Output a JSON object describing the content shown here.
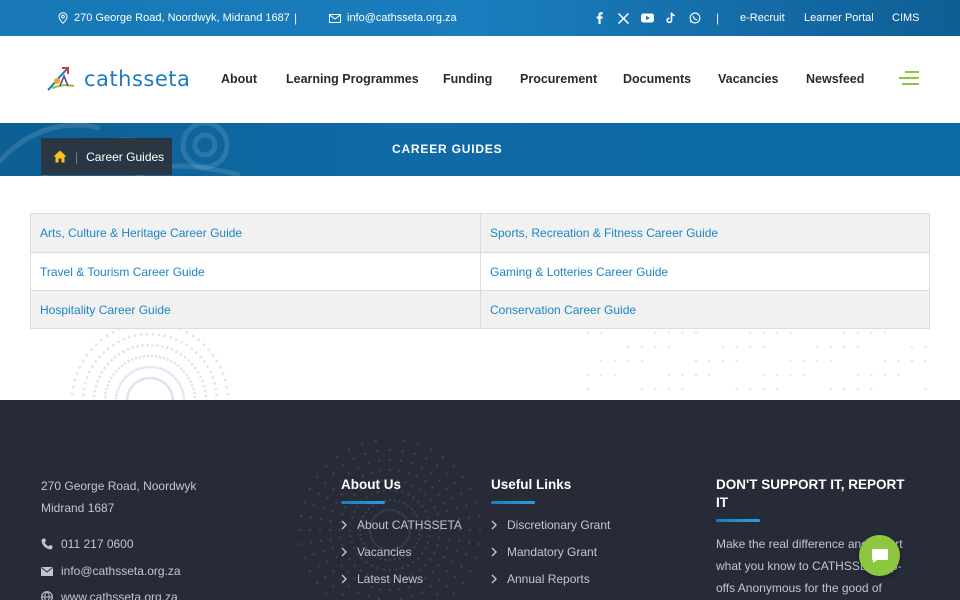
{
  "topbar": {
    "address": "270 George Road, Noordwyk, Midrand 1687",
    "email": "info@cathsseta.org.za",
    "divider": "|",
    "social": [
      "facebook-icon",
      "x-icon",
      "youtube-icon",
      "tiktok-icon",
      "whatsapp-icon"
    ],
    "links": [
      "e-Recruit",
      "Learner Portal",
      "CIMS"
    ]
  },
  "header": {
    "logo_text": "cathsseta",
    "nav": [
      "About",
      "Learning Programmes",
      "Funding",
      "Procurement",
      "Documents",
      "Vacancies",
      "Newsfeed"
    ]
  },
  "banner": {
    "title": "CAREER GUIDES",
    "breadcrumb_current": "Career Guides",
    "breadcrumb_sep": "|"
  },
  "guides": [
    [
      "Arts, Culture & Heritage Career Guide",
      "Sports, Recreation & Fitness Career Guide"
    ],
    [
      "Travel & Tourism Career Guide",
      "Gaming & Lotteries Career Guide"
    ],
    [
      "Hospitality Career Guide",
      "Conservation Career Guide"
    ]
  ],
  "footer": {
    "address_line1": "270 George Road, Noordwyk",
    "address_line2": "Midrand 1687",
    "phone": "011 217 0600",
    "email": "info@cathsseta.org.za",
    "website": "www.cathsseta.org.za",
    "about_heading": "About Us",
    "about_links": [
      "About CATHSSETA",
      "Vacancies",
      "Latest News"
    ],
    "useful_heading": "Useful Links",
    "useful_links": [
      "Discretionary Grant",
      "Mandatory Grant",
      "Annual Reports"
    ],
    "report_heading_1": "DON'T SUPPORT IT, REPORT",
    "report_heading_2": "IT",
    "report_text_1": "Make the real difference and report",
    "report_text_2": "what you know to CATHSSETA tip-",
    "report_text_3": "offs Anonymous for the good of"
  },
  "colors": {
    "brand_blue": "#1a7dbd",
    "accent_green": "#8dc63f",
    "footer_bg": "#272b38",
    "link_blue": "#1b86c4"
  }
}
